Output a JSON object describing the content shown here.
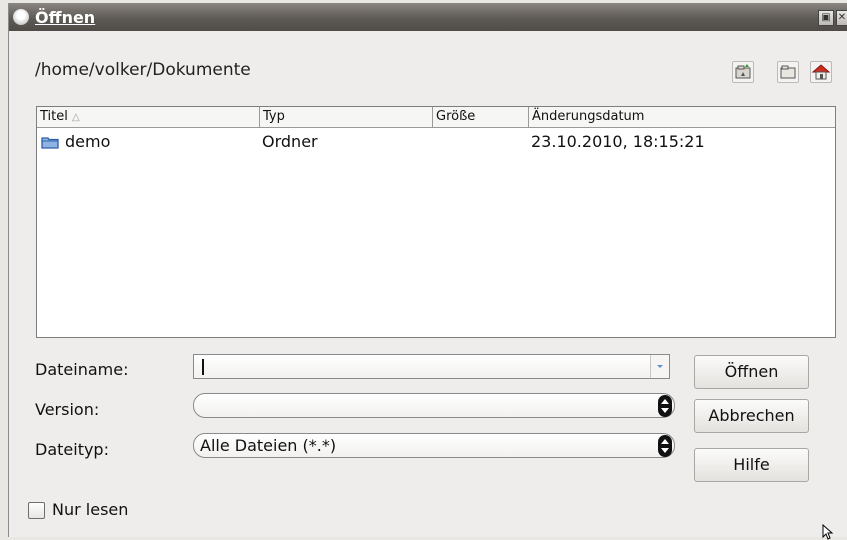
{
  "window": {
    "title": "Öffnen"
  },
  "toolbar": {
    "path": "/home/volker/Dokumente"
  },
  "file_list": {
    "columns": [
      "Titel",
      "Typ",
      "Größe",
      "Änderungsdatum"
    ],
    "rows": [
      {
        "name": "demo",
        "type": "Ordner",
        "size": "",
        "modified": "23.10.2010, 18:15:21"
      }
    ]
  },
  "form": {
    "filename_label": "Dateiname:",
    "filename_value": "",
    "version_label": "Version:",
    "version_value": "",
    "filetype_label": "Dateityp:",
    "filetype_value": "Alle Dateien (*.*)",
    "readonly_label": "Nur lesen"
  },
  "buttons": {
    "open": "Öffnen",
    "cancel": "Abbrechen",
    "help": "Hilfe"
  }
}
